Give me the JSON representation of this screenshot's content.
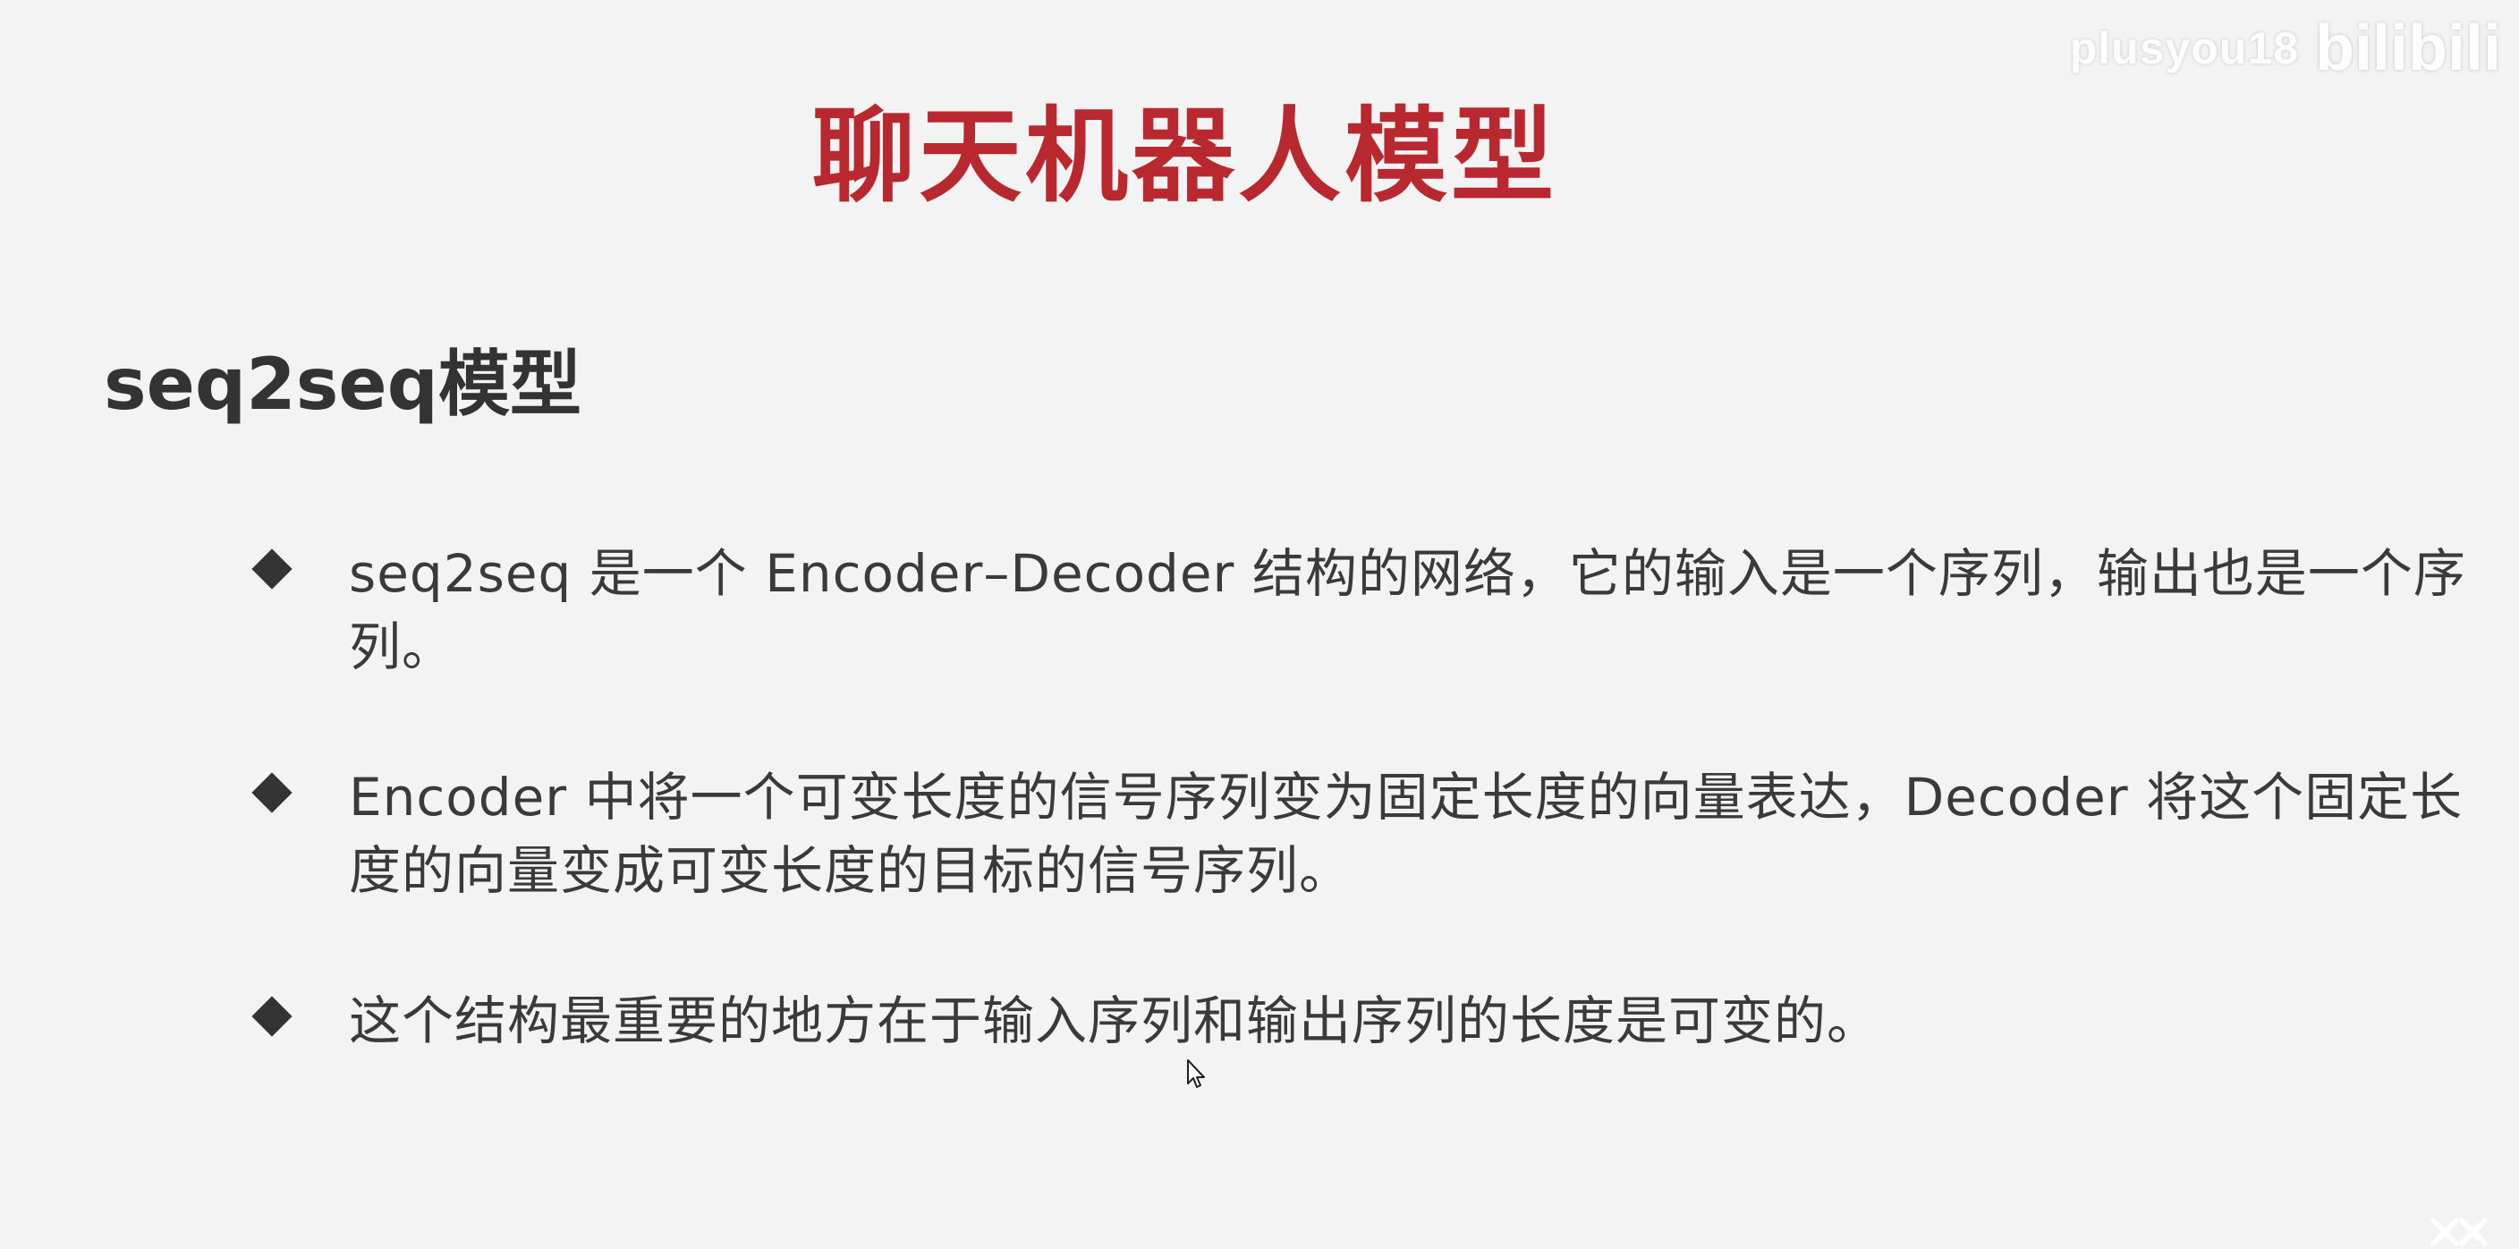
{
  "watermark": {
    "user": "plusyou18",
    "logo": "bilibili"
  },
  "slide": {
    "title": "聊天机器人模型",
    "subtitle": "seq2seq模型",
    "bullets": [
      "seq2seq 是一个 Encoder–Decoder 结构的网络，它的输入是一个序列，输出也是一个序列。",
      " Encoder 中将一个可变长度的信号序列变为固定长度的向量表达，Decoder 将这个固定长度的向量变成可变长度的目标的信号序列。",
      "这个结构最重要的地方在于输入序列和输出序列的长度是可变的。"
    ]
  },
  "colors": {
    "title": "#b8282e",
    "text": "#3a3a3a",
    "background": "#f3f3f3"
  },
  "icons": {
    "bullet": "diamond-bullet-icon",
    "cursor": "mouse-pointer-icon",
    "close": "close-icon"
  }
}
